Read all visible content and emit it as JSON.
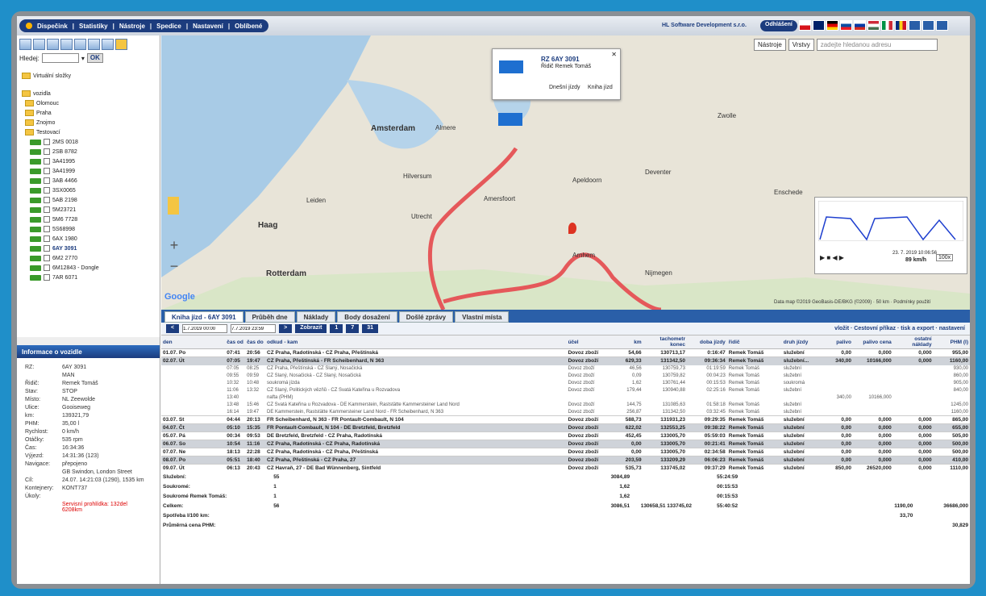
{
  "menu": [
    "Dispečink",
    "Statistiky",
    "Nástroje",
    "Spedice",
    "Nastavení",
    "Oblíbené"
  ],
  "company": "HL Software Development s.r.o.",
  "logout": "Odhlášení",
  "search": {
    "label": "Hledej:",
    "ok": "OK"
  },
  "tree": {
    "virtual": "Virtuální složky",
    "root": "vozidla",
    "folders": [
      "Olomouc",
      "Praha",
      "Znojmo",
      "Testovací"
    ],
    "vehicles": [
      "2MS 0018",
      "2SB 8782",
      "3A41995",
      "3A41999",
      "3AB 4466",
      "3SX0065",
      "5AB 2198",
      "5M23721",
      "5M6 7728",
      "5S68998",
      "6AX 1980",
      "6AY 3091",
      "6M2 2770",
      "6M12843 - Dongle",
      "7AR 6071"
    ]
  },
  "info": {
    "title": "Informace o vozidle",
    "rows": [
      {
        "l": "RZ:",
        "v": "6AY 3091"
      },
      {
        "l": "",
        "v": "MAN"
      },
      {
        "l": "Řidič:",
        "v": "Remek Tomáš"
      },
      {
        "l": "Stav:",
        "v": "STOP"
      },
      {
        "l": "Místo:",
        "v": "NL Zeewolde"
      },
      {
        "l": "Ulice:",
        "v": "Gooiseweg"
      },
      {
        "l": "km:",
        "v": "139321,79"
      },
      {
        "l": "PHM:",
        "v": "35,00 l"
      },
      {
        "l": "Rychlost:",
        "v": "0 km/h"
      },
      {
        "l": "Otáčky:",
        "v": "535 rpm"
      },
      {
        "l": "Čas:",
        "v": "16:34:36"
      },
      {
        "l": "Výjezd:",
        "v": "14:31:36 (123)"
      },
      {
        "l": "Navigace:",
        "v": "přepojeno"
      },
      {
        "l": "",
        "v": "GB Swindon, London Street"
      },
      {
        "l": "Cíl:",
        "v": "24.07. 14:21:03 (1290), 1535 km"
      },
      {
        "l": "Kontejnery:",
        "v": "KONT737"
      },
      {
        "l": "Úkoly:",
        "v": ""
      }
    ],
    "warning": "Servisní prohlídka: 132del 6208km"
  },
  "map": {
    "tools": "Nástroje",
    "layers": "Vrstvy",
    "search_ph": "zadejte hledanou adresu",
    "popup": {
      "rz": "RZ 6AY 3091",
      "driver": "Řidič Remek Tomáš",
      "a": "Dnešní jízdy",
      "b": "Kniha jízd"
    },
    "labels": [
      "Amsterdam",
      "Haag",
      "Rotterdam",
      "Utrecht",
      "Almere",
      "Apeldoorn",
      "Arnhem",
      "Amersfoort",
      "Deventer",
      "Enschede",
      "Hilversum",
      "Leiden",
      "Nijmegen",
      "Zwolle"
    ],
    "speed": "89 km/h",
    "date": "23. 7. 2019 10:06:56",
    "zoom": "100x",
    "copyright": "Data map ©2019 GeoBasis-DE/BKG (©2009) · 50 km · Podmínky použití",
    "google": "Google"
  },
  "tabs": [
    "Kniha jízd - 6AY 3091",
    "Průběh dne",
    "Náklady",
    "Body dosažení",
    "Došlé zprávy",
    "Vlastní místa"
  ],
  "filter": {
    "from": "1.7.2019 00:00",
    "to": "7.7.2019 23:59",
    "show": "Zobrazit",
    "b1": "1",
    "b7": "7",
    "b31": "31",
    "links": "vložit · Cestovní příkaz · tisk a export · nastavení"
  },
  "columns": [
    "den",
    "čas od",
    "čas do",
    "odkud - kam",
    "účel",
    "km",
    "tachometr konec",
    "doba jízdy",
    "řidič",
    "druh jízdy",
    "palivo",
    "palivo cena",
    "ostatní náklady",
    "PHM (l)"
  ],
  "rows": [
    {
      "k": "day",
      "c": [
        "01.07. Po",
        "07:41",
        "20:56",
        "CZ Praha, Radotínská - CZ Praha, Přeštínská",
        "Dovoz zboží",
        "54,66",
        "130713,17",
        "0:16:47",
        "Remek Tomáš",
        "služební",
        "0,00",
        "0,000",
        "0,000",
        "955,00"
      ]
    },
    {
      "k": "day gray",
      "c": [
        "02.07. Út",
        "07:05",
        "19:47",
        "CZ Praha, Přeštínská - FR Scheibenhard, N 363",
        "Dovoz zboží",
        "629,33",
        "131342,50",
        "09:36:34",
        "Remek Tomáš",
        "služební...",
        "340,00",
        "10166,000",
        "0,000",
        "1160,00"
      ]
    },
    {
      "k": "sub",
      "c": [
        "",
        "07:05",
        "08:25",
        "CZ Praha, Přeštínská - CZ Slaný, Nosačická",
        "Dovoz zboží",
        "46,56",
        "130759,73",
        "01:19:59",
        "Remek Tomáš",
        "služební",
        "",
        "",
        "",
        "930,00"
      ]
    },
    {
      "k": "sub",
      "c": [
        "",
        "09:55",
        "09:59",
        "CZ Slaný, Nosačická - CZ Slaný, Nosačická",
        "Dovoz zboží",
        "0,09",
        "130759,82",
        "00:04:23",
        "Remek Tomáš",
        "služební",
        "",
        "",
        "",
        "860,00"
      ]
    },
    {
      "k": "sub",
      "c": [
        "",
        "10:32",
        "10:48",
        "soukromá jízda",
        "Dovoz zboží",
        "1,62",
        "130761,44",
        "00:15:53",
        "Remek Tomáš",
        "soukromá",
        "",
        "",
        "",
        "905,00"
      ]
    },
    {
      "k": "sub",
      "c": [
        "",
        "11:06",
        "13:32",
        "CZ Slaný, Politických vězňů - CZ Svatá Kateřina u Rozvadova",
        "Dovoz zboží",
        "179,44",
        "130940,88",
        "02:25:16",
        "Remek Tomáš",
        "služební",
        "",
        "",
        "",
        "840,00"
      ]
    },
    {
      "k": "sub",
      "c": [
        "",
        "13:40",
        "",
        "nafta (PHM)",
        "",
        "",
        "",
        "",
        "",
        "",
        "340,00",
        "10166,000",
        "",
        ""
      ]
    },
    {
      "k": "sub",
      "c": [
        "",
        "13:48",
        "15:46",
        "CZ Svatá Kateřina u Rozvadova - DE Kammerstein, Raststätte Kammersteiner Land Nord",
        "Dovoz zboží",
        "144,75",
        "131085,63",
        "01:58:18",
        "Remek Tomáš",
        "služební",
        "",
        "",
        "",
        "1245,00"
      ]
    },
    {
      "k": "sub",
      "c": [
        "",
        "16:14",
        "19:47",
        "DE Kammerstein, Raststätte Kammersteiner Land Nord - FR Scheibenhard, N 363",
        "Dovoz zboží",
        "256,87",
        "131342,50",
        "03:32:45",
        "Remek Tomáš",
        "služební",
        "",
        "",
        "",
        "1160,00"
      ]
    },
    {
      "k": "day",
      "c": [
        "03.07. St",
        "04:44",
        "20:13",
        "FR Scheibenhard, N 363 - FR Pontault-Combault, N 104",
        "Dovoz zboží",
        "588,73",
        "131931,23",
        "09:29:35",
        "Remek Tomáš",
        "služební",
        "0,00",
        "0,000",
        "0,000",
        "865,00"
      ]
    },
    {
      "k": "day gray",
      "c": [
        "04.07. Čt",
        "05:10",
        "15:35",
        "FR Pontault-Combault, N 104 - DE Bretzfeld, Bretzfeld",
        "Dovoz zboží",
        "622,02",
        "132553,25",
        "09:38:22",
        "Remek Tomáš",
        "služební",
        "0,00",
        "0,000",
        "0,000",
        "655,00"
      ]
    },
    {
      "k": "day",
      "c": [
        "05.07. Pá",
        "00:34",
        "09:53",
        "DE Bretzfeld, Bretzfeld - CZ Praha, Radotínská",
        "Dovoz zboží",
        "452,45",
        "133005,70",
        "05:59:03",
        "Remek Tomáš",
        "služební",
        "0,00",
        "0,000",
        "0,000",
        "505,00"
      ]
    },
    {
      "k": "day gray",
      "c": [
        "06.07. So",
        "10:54",
        "11:16",
        "CZ Praha, Radotínská - CZ Praha, Radotínská",
        "Dovoz zboží",
        "0,00",
        "133005,70",
        "00:21:41",
        "Remek Tomáš",
        "služební",
        "0,00",
        "0,000",
        "0,000",
        "500,00"
      ]
    },
    {
      "k": "day",
      "c": [
        "07.07. Ne",
        "18:13",
        "22:28",
        "CZ Praha, Radotínská - CZ Praha, Přeštínská",
        "Dovoz zboží",
        "0,00",
        "133005,70",
        "02:34:58",
        "Remek Tomáš",
        "služební",
        "0,00",
        "0,000",
        "0,000",
        "500,00"
      ]
    },
    {
      "k": "day gray",
      "c": [
        "08.07. Po",
        "05:51",
        "18:40",
        "CZ Praha, Přeštínská - CZ Praha, 27",
        "Dovoz zboží",
        "203,59",
        "133209,29",
        "06:06:23",
        "Remek Tomáš",
        "služební",
        "0,00",
        "0,000",
        "0,000",
        "410,00"
      ]
    },
    {
      "k": "day",
      "c": [
        "09.07. Út",
        "06:13",
        "20:43",
        "CZ Havraň, 27 - DE Bad Wünnenberg, Sintfeld",
        "Dovoz zboží",
        "535,73",
        "133745,02",
        "09:37:29",
        "Remek Tomáš",
        "služební",
        "850,00",
        "26520,000",
        "0,000",
        "1110,00"
      ]
    }
  ],
  "summary": [
    {
      "a": "Služební:",
      "b": "55",
      "km": "3084,89",
      "t": "",
      "d": "55:24:59",
      "p": "",
      "pc": ""
    },
    {
      "a": "Soukromé:",
      "b": "1",
      "km": "1,62",
      "t": "",
      "d": "00:15:53",
      "p": "",
      "pc": ""
    },
    {
      "a": "Soukromé Remek Tomáš:",
      "b": "1",
      "km": "1,62",
      "t": "",
      "d": "00:15:53",
      "p": "",
      "pc": ""
    },
    {
      "a": "Celkem:",
      "b": "56",
      "km": "3086,51",
      "t": "130658,51 133745,02",
      "d": "55:40:52",
      "p": "1190,00",
      "pc": "36686,000"
    },
    {
      "a": "Spotřeba l/100 km:",
      "b": "",
      "km": "",
      "t": "",
      "d": "",
      "p": "33,70",
      "pc": ""
    },
    {
      "a": "Průměrná cena PHM:",
      "b": "",
      "km": "",
      "t": "",
      "d": "",
      "p": "",
      "pc": "30,829"
    }
  ]
}
